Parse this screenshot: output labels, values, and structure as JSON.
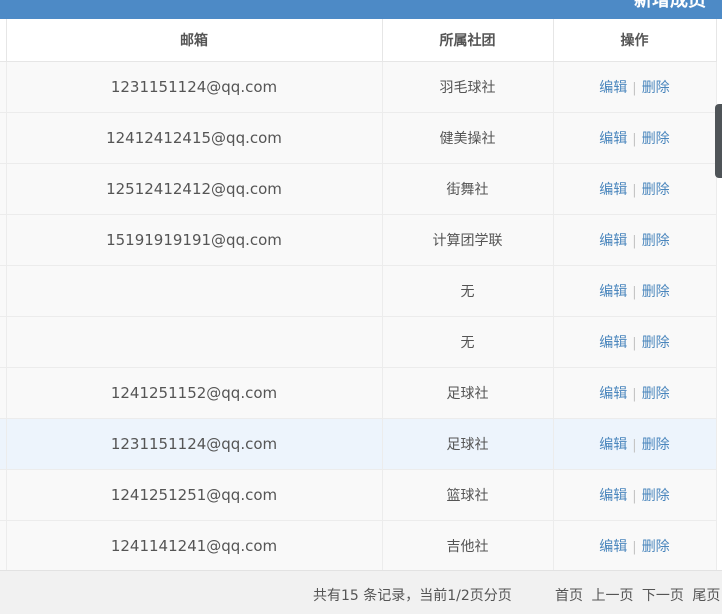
{
  "header": {
    "title": "新增成员"
  },
  "table": {
    "columns": {
      "email": "邮箱",
      "club": "所属社团",
      "actions": "操作"
    },
    "rows": [
      {
        "email": "1231151124@qq.com",
        "club": "羽毛球社"
      },
      {
        "email": "12412412415@qq.com",
        "club": "健美操社"
      },
      {
        "email": "12512412412@qq.com",
        "club": "街舞社"
      },
      {
        "email": "15191919191@qq.com",
        "club": "计算团学联"
      },
      {
        "email": "",
        "club": "无"
      },
      {
        "email": "",
        "club": "无"
      },
      {
        "email": "1241251152@qq.com",
        "club": "足球社"
      },
      {
        "email": "1231151124@qq.com",
        "club": "足球社"
      },
      {
        "email": "1241251251@qq.com",
        "club": "篮球社"
      },
      {
        "email": "1241141241@qq.com",
        "club": "吉他社"
      }
    ],
    "edit_label": "编辑",
    "delete_label": "删除",
    "separator": "|"
  },
  "footer": {
    "record_info": "共有15 条记录，当前1/2页分页",
    "first_page": "首页",
    "prev_page": "上一页",
    "next_page": "下一页",
    "last_page": "尾页"
  },
  "colors": {
    "header_bar": "#4d8ac6",
    "link": "#4a86bd",
    "highlight_row": "#edf4fc"
  }
}
